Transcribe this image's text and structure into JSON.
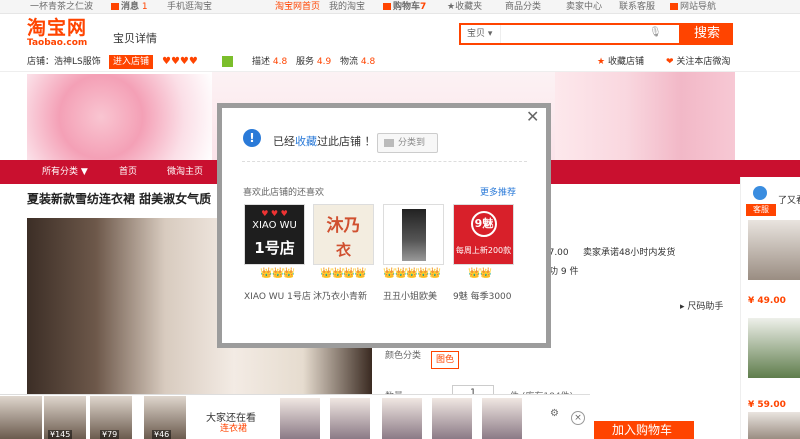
{
  "topbar": {
    "user": "一杯青茶之仁波",
    "messages": "消息",
    "messages_count": "1",
    "mobile": "手机逛淘宝",
    "home": "淘宝网首页",
    "my_taobao": "我的淘宝",
    "cart": "购物车",
    "cart_count": "7",
    "favorites": "收藏夹",
    "categories": "商品分类",
    "seller": "卖家中心",
    "support": "联系客服",
    "sitemap": "网站导航"
  },
  "header": {
    "logo": "淘宝网",
    "logo_sub": "Taobao.com",
    "page_label": "宝贝详情",
    "search_scope": "宝贝",
    "search_button": "搜索"
  },
  "shopbar": {
    "shop_label": "店铺：",
    "shop_name": "浩神LS服饰",
    "enter_shop": "进入店铺",
    "rating_desc": "描述",
    "rating_desc_val": "4.8",
    "rating_service": "服务",
    "rating_service_val": "4.9",
    "rating_logistics": "物流",
    "rating_logistics_val": "4.8",
    "fav_shop": "收藏店铺",
    "follow_shop": "关注本店微淘"
  },
  "nav": {
    "all_categories": "所有分类",
    "home": "首页",
    "weitao": "微淘主页"
  },
  "product": {
    "title": "夏装新款雪纺连衣裙 甜美淑女气质",
    "price_info": "¥ 7.00",
    "promise": "卖家承诺48小时内发货",
    "sales": "成功 9 件",
    "size_helper": "尺码助手",
    "color_label": "颜色分类",
    "color_option": "图色",
    "qty_label": "数量",
    "qty_value": "1",
    "stock": "件 (库存184件)",
    "add_cart": "加入购物车"
  },
  "right_panel": {
    "service": "客服",
    "label": "了又看",
    "prices": [
      "¥ 49.00",
      "¥ 59.00"
    ]
  },
  "bottom": {
    "thumb_prices": [
      "¥145",
      "¥79",
      "¥46"
    ],
    "everyone_title": "大家还在看",
    "everyone_sub": "连衣裙"
  },
  "modal": {
    "message_prefix": "已经",
    "message_link": "收藏",
    "message_suffix": "过此店铺 ！",
    "category_button": "分类到",
    "subtitle": "喜欢此店铺的还喜欢",
    "more": "更多推荐",
    "shops": [
      {
        "name": "XIAO WU 1号店",
        "logo_line1": "XIAO WU",
        "logo_line2": "1号店",
        "crowns": "👑👑👑"
      },
      {
        "name": "沐乃衣小青新",
        "logo_line1": "沐乃",
        "logo_line2": "衣",
        "crowns": "👑👑👑👑"
      },
      {
        "name": "丑丑小姐欧美",
        "logo_line1": "",
        "logo_line2": "",
        "crowns": "👑👑👑👑👑"
      },
      {
        "name": "9魅 每季3000",
        "logo_line1": "9魅",
        "logo_line2": "每周上新200款",
        "crowns": "👑👑"
      }
    ]
  }
}
